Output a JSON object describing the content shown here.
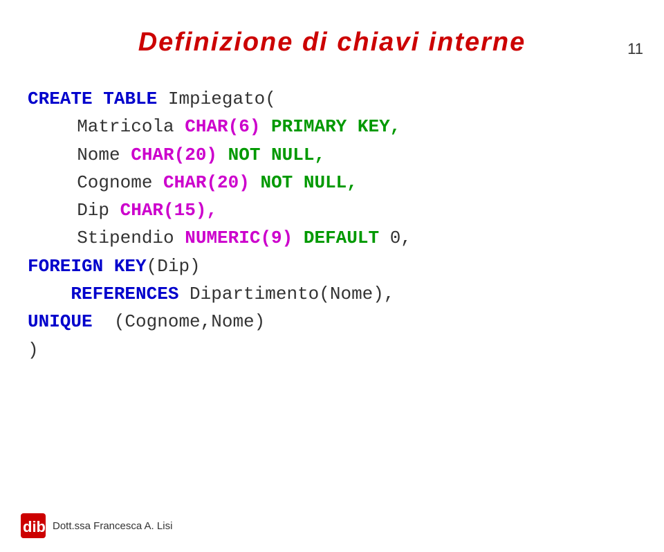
{
  "page": {
    "number": "11",
    "title": "Definizione di chiavi interne",
    "footer_text": "Dott.ssa Francesca A. Lisi"
  },
  "code": {
    "line1_kw1": "CREATE",
    "line1_kw2": "TABLE",
    "line1_plain": " Impiegato(",
    "line2_indent": "  Matricola ",
    "line2_kw": "CHAR(6)",
    "line2_kw2": " PRIMARY KEY,",
    "line3_indent": "  Nome ",
    "line3_kw": "CHAR(20)",
    "line3_kw2": " NOT NULL,",
    "line4_indent": "  Cognome ",
    "line4_kw": "CHAR(20)",
    "line4_kw2": " NOT NULL,",
    "line5_indent": "  Dip ",
    "line5_kw": "CHAR(15),",
    "line6_indent": "  Stipendio ",
    "line6_kw": "NUMERIC(9)",
    "line6_kw2": " DEFAULT",
    "line6_val": " 0,",
    "line7_kw1": "FOREIGN",
    "line7_kw2": "KEY",
    "line7_plain": "(Dip)",
    "line8_kw": "    REFERENCES",
    "line8_plain": " Dipartimento(Nome),",
    "line9_kw": "UNIQUE",
    "line9_plain": "  (Cognome,Nome)",
    "line10_plain": ")"
  }
}
